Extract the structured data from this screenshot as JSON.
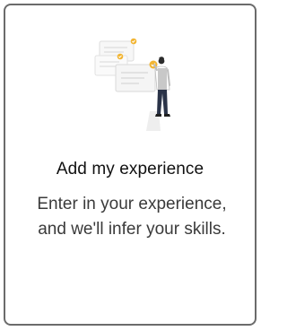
{
  "card": {
    "title": "Add my experience",
    "description": "Enter in your experience, and we'll infer your skills.",
    "illustration": "person-with-documents-illustration"
  },
  "colors": {
    "border": "#6b6b6b",
    "accent": "#f2b533",
    "title": "#111111",
    "text": "#3a3a3a"
  }
}
